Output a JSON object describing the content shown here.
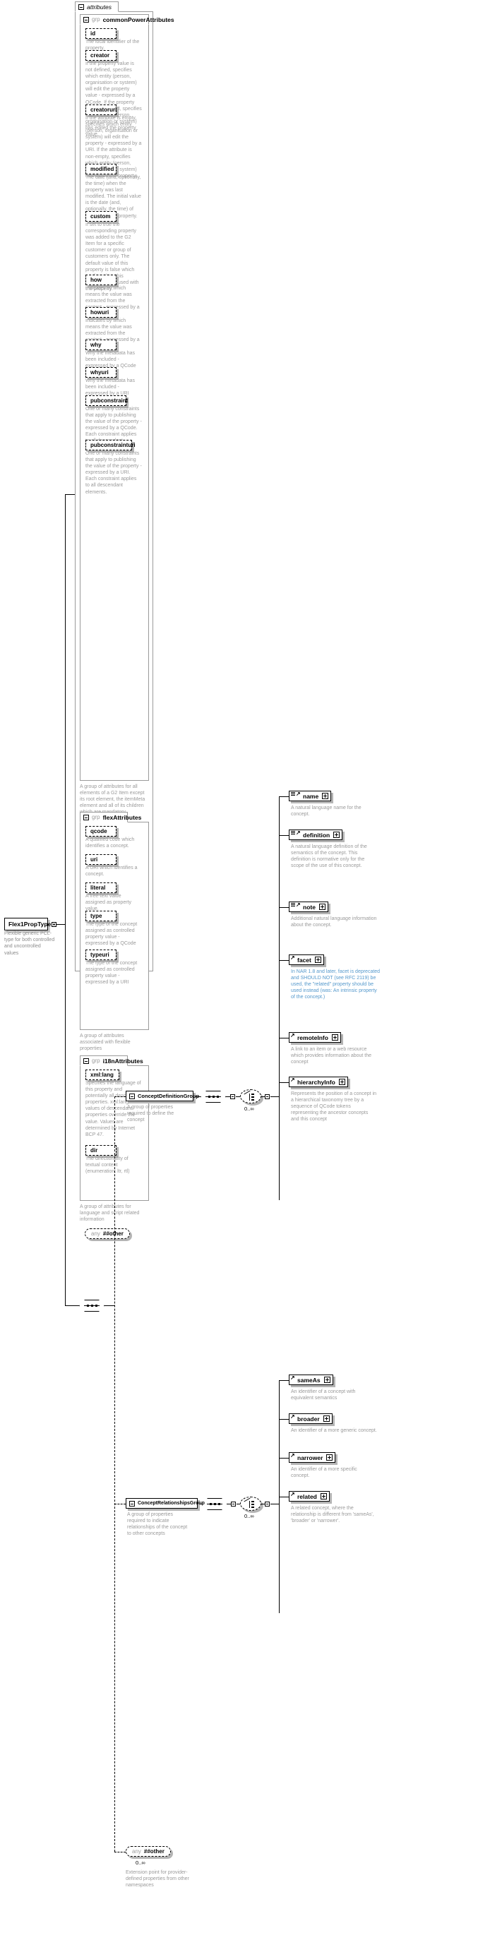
{
  "root": {
    "type_name": "Flex1PropType",
    "type_desc": "Flexible generic PCL-type for both controlled and uncontrolled values"
  },
  "attributes_panel": {
    "title": "attributes"
  },
  "groups": {
    "commonPowerAttributes": {
      "keyword": "grp",
      "name": "commonPowerAttributes",
      "desc": "A group of attributes for all elements of a G2 Item except its root element, the itemMeta element and all of its children which are mandatory.",
      "attributes": [
        {
          "name": "id",
          "desc": "The local identifier of the property."
        },
        {
          "name": "creator",
          "desc": "If the property value is not defined, specifies which entity (person, organisation or system) will edit the property value - expressed by a QCode. If the property value is defined, specifies which entity (person, organisation or system) has edited the property value."
        },
        {
          "name": "creatoruri",
          "desc": "If the attribute is empty, specifies which entity (person, organisation or system) will edit the property - expressed by a URI. If the attribute is non-empty, specifies which entity (person, organisation or system) has edited the property."
        },
        {
          "name": "modified",
          "desc": "The date (and, optionally, the time) when the property was last modified. The initial value is the date (and, optionally, the time) of creation of the property."
        },
        {
          "name": "custom",
          "desc": "If set to true the corresponding property was added to the G2 Item for a specific customer or group of customers only. The default value of this property is false which applies when this attribute is not used with the property."
        },
        {
          "name": "how",
          "desc": "Indicates by which means the value was extracted from the content - expressed by a QCode"
        },
        {
          "name": "howuri",
          "desc": "Indicates by which means the value was extracted from the content - expressed by a URI"
        },
        {
          "name": "why",
          "desc": "Why the metadata has been included - expressed by a QCode"
        },
        {
          "name": "whyuri",
          "desc": "Why the metadata has been included - expressed by a URI"
        },
        {
          "name": "pubconstraint",
          "desc": "One or many constraints that apply to publishing the value of the property - expressed by a QCode. Each constraint applies to all descendant elements."
        },
        {
          "name": "pubconstrainturi",
          "desc": "One or many constraints that apply to publishing the value of the property - expressed by a URI. Each constraint applies to all descendant elements."
        }
      ]
    },
    "flexAttributes": {
      "keyword": "grp",
      "name": "flexAttributes",
      "desc": "A group of attributes associated with flexible properties",
      "attributes": [
        {
          "name": "qcode",
          "desc": "A qualified code which identifies a concept."
        },
        {
          "name": "uri",
          "desc": "A URI which identifies a concept."
        },
        {
          "name": "literal",
          "desc": "A free-text value assigned as property value."
        },
        {
          "name": "type",
          "desc": "The type of the concept assigned as controlled property value - expressed by a QCode"
        },
        {
          "name": "typeuri",
          "desc": "The type of the concept assigned as controlled property value - expressed by a URI"
        }
      ]
    },
    "i18nAttributes": {
      "keyword": "grp",
      "name": "i18nAttributes",
      "desc": "A group of attributes for language and script related information",
      "attributes": [
        {
          "name": "xml:lang",
          "desc": "Specifies the language of this property and potentially all descendant properties. xml:lang values of descendant properties override the value. Values are determined by Internet BCP 47."
        },
        {
          "name": "dir",
          "desc": "The directionality of textual content (enumeration: ltr, rtl)"
        }
      ]
    }
  },
  "attr_any": {
    "keyword": "any",
    "name": "##other"
  },
  "content_model": {
    "sequence_label": "sequence",
    "branches": [
      {
        "id": "concept-definition-group",
        "keyword": "grp",
        "name": "ConceptDefinitionGroup",
        "desc": "A group of properties required to define the concept",
        "cardinality": "0..∞",
        "elements": [
          {
            "name": "name",
            "desc": "A natural language name for the concept."
          },
          {
            "name": "definition",
            "desc": "A natural language definition of the semantics of the concept. This definition is normative only for the scope of the use of this concept."
          },
          {
            "name": "note",
            "desc": "Additional natural language information about the concept."
          },
          {
            "name": "facet",
            "desc": "In NAR 1.8 and later, facet is deprecated and SHOULD NOT (see RFC 2119) be used, the \"related\" property should be used instead (was: An intrinsic property of the concept.)"
          },
          {
            "name": "remoteInfo",
            "desc": "A link to an item or a web resource which provides information about the concept"
          },
          {
            "name": "hierarchyInfo",
            "desc": "Represents the position of a concept in a hierarchical taxonomy tree by a sequence of QCode tokens representing the ancestor concepts and this concept"
          }
        ]
      },
      {
        "id": "concept-relationships-group",
        "keyword": "grp",
        "name": "ConceptRelationshipsGroup",
        "desc": "A group of properties required to indicate relationships of the concept to other concepts",
        "cardinality": "0..∞",
        "elements": [
          {
            "name": "sameAs",
            "desc": "An identifier of a concept with equivalent semantics"
          },
          {
            "name": "broader",
            "desc": "An identifier of a more generic concept."
          },
          {
            "name": "narrower",
            "desc": "An identifier of a more specific concept."
          },
          {
            "name": "related",
            "desc": "A related concept, where the relationship is different from 'sameAs', 'broader' or 'narrower'."
          }
        ]
      }
    ],
    "any_branch": {
      "keyword": "any",
      "name": "##other",
      "cardinality": "0..∞",
      "desc": "Extension point for provider-defined properties from other namespaces"
    }
  }
}
